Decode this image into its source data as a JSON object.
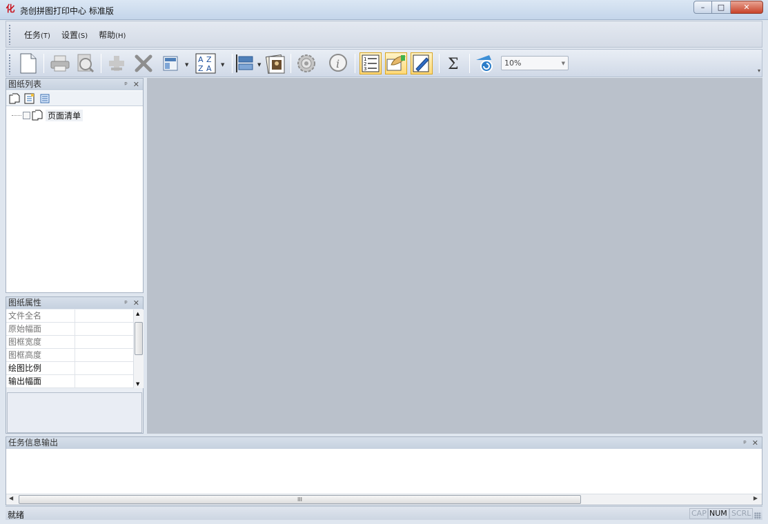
{
  "window": {
    "title": "尧创拼图打印中心 标准版",
    "app_icon_glyph": "化",
    "controls": {
      "minimize": "–",
      "maximize": "□",
      "close": "✕"
    }
  },
  "menu": {
    "items": [
      {
        "label": "任务",
        "accel": "(T)"
      },
      {
        "label": "设置",
        "accel": "(S)"
      },
      {
        "label": "帮助",
        "accel": "(H)"
      }
    ]
  },
  "toolbar": {
    "zoom_value": "10%",
    "icons": [
      "new-document-icon",
      "print-icon",
      "print-preview-icon",
      "add-icon",
      "delete-icon",
      "layout-icon",
      "sort-az-icon",
      "align-icon",
      "gallery-icon",
      "settings-gear-icon",
      "info-icon",
      "numbered-list-icon",
      "stamp-icon",
      "edit-pen-icon",
      "sum-icon",
      "refresh-icon"
    ]
  },
  "sheet_list_panel": {
    "title": "图纸列表",
    "pin": "ᵖ",
    "close": "✕",
    "tree": [
      {
        "label": "页面清单",
        "checked": false
      }
    ]
  },
  "sheet_props_panel": {
    "title": "图纸属性",
    "pin": "ᵖ",
    "close": "✕",
    "rows": [
      {
        "name": "文件全名",
        "value": ""
      },
      {
        "name": "原始幅面",
        "value": ""
      },
      {
        "name": "图框宽度",
        "value": ""
      },
      {
        "name": "图框高度",
        "value": ""
      },
      {
        "name": "绘图比例",
        "value": ""
      },
      {
        "name": "输出幅面",
        "value": ""
      }
    ]
  },
  "output_panel": {
    "title": "任务信息输出",
    "pin": "ᵖ",
    "close": "✕",
    "scroll_grip": "III"
  },
  "statusbar": {
    "text": "就绪",
    "indicators": [
      {
        "label": "CAP",
        "on": false
      },
      {
        "label": "NUM",
        "on": true
      },
      {
        "label": "SCRL",
        "on": false
      }
    ]
  },
  "colors": {
    "workspace": "#bac1cb",
    "active_button": "#ffd977",
    "close_button": "#c8432a"
  }
}
